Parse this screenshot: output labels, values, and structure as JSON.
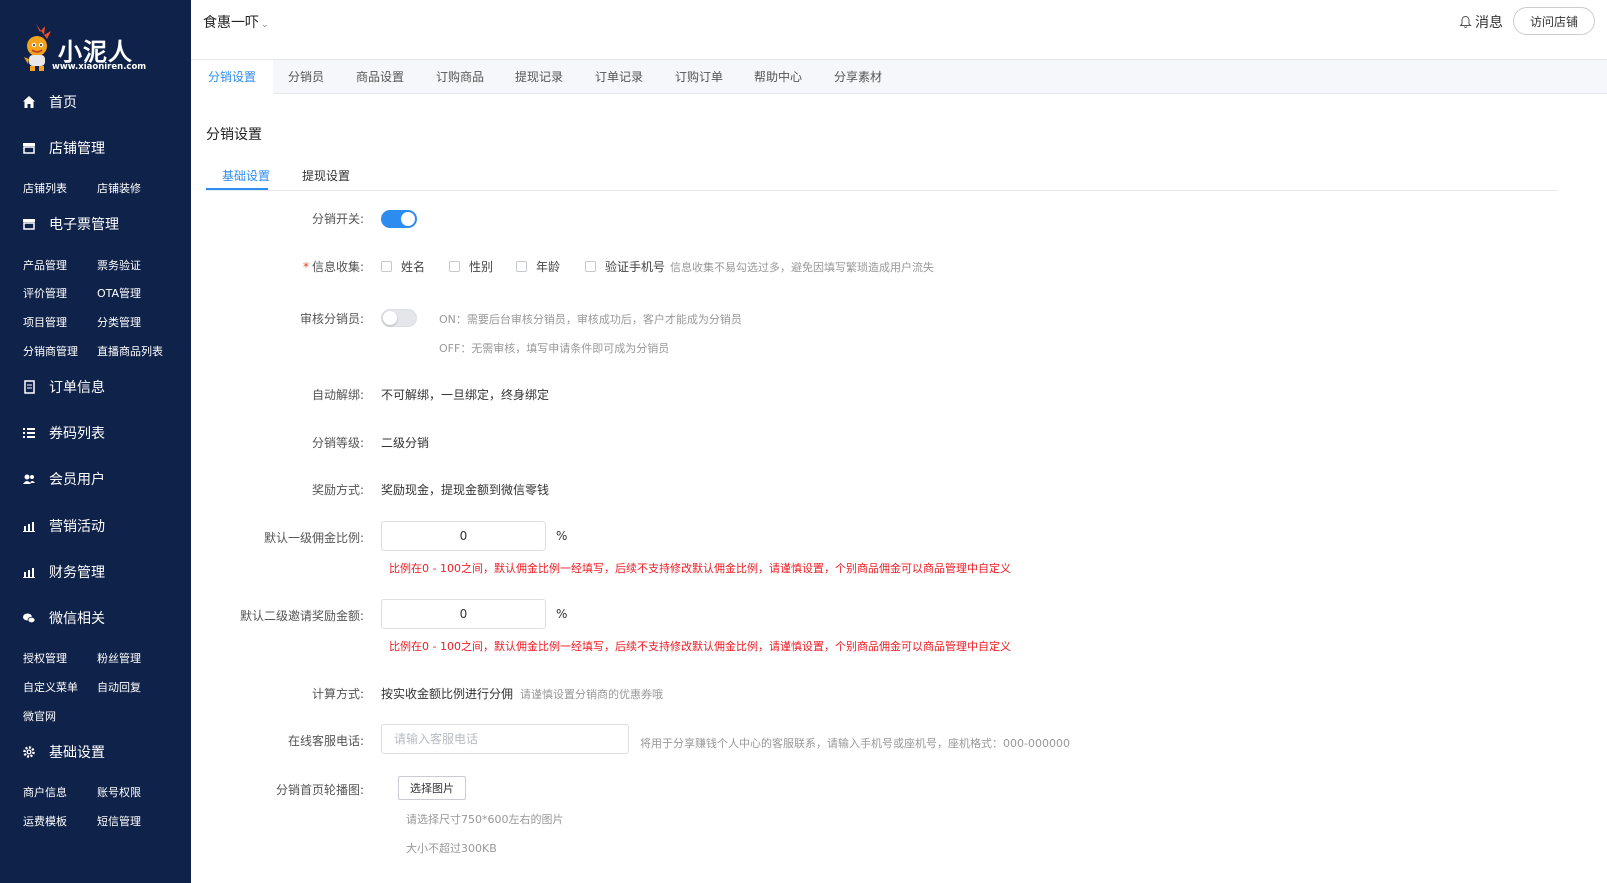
{
  "brand": {
    "name": "小泥人",
    "url": "www.xiaoniren.com"
  },
  "sidebar": {
    "home": "首页",
    "store": {
      "label": "店铺管理",
      "items": [
        "店铺列表",
        "店铺装修"
      ]
    },
    "eticket": {
      "label": "电子票管理",
      "items": [
        "产品管理",
        "票务验证",
        "评价管理",
        "OTA管理",
        "项目管理",
        "分类管理",
        "分销商管理",
        "直播商品列表"
      ]
    },
    "orders": "订单信息",
    "coupons": "券码列表",
    "members": "会员用户",
    "marketing": "营销活动",
    "finance": "财务管理",
    "wechat": {
      "label": "微信相关",
      "items": [
        "授权管理",
        "粉丝管理",
        "自定义菜单",
        "自动回复",
        "微官网"
      ]
    },
    "settings": {
      "label": "基础设置",
      "items": [
        "商户信息",
        "账号权限",
        "运费模板",
        "短信管理"
      ]
    }
  },
  "header": {
    "shop_name": "食惠一吓",
    "messages": "消息",
    "visit_store": "访问店铺"
  },
  "topnav": {
    "tabs": [
      "分销设置",
      "分销员",
      "商品设置",
      "订购商品",
      "提现记录",
      "订单记录",
      "订购订单",
      "帮助中心",
      "分享素材"
    ],
    "active": 0
  },
  "page": {
    "title": "分销设置",
    "subtabs": [
      "基础设置",
      "提现设置"
    ],
    "active_subtab": 0
  },
  "form": {
    "switch_label": "分销开关:",
    "switch_on": true,
    "info_label": "信息收集:",
    "info_options": [
      "姓名",
      "性别",
      "年龄",
      "验证手机号"
    ],
    "info_hint": "信息收集不易勾选过多，避免因填写繁琐造成用户流失",
    "review_label": "审核分销员:",
    "review_on": false,
    "review_hint_on": "ON：需要后台审核分销员，审核成功后，客户才能成为分销员",
    "review_hint_off": "OFF：无需审核，填写申请条件即可成为分销员",
    "unbind_label": "自动解绑:",
    "unbind_value": "不可解绑，一旦绑定，终身绑定",
    "level_label": "分销等级:",
    "level_value": "二级分销",
    "reward_label": "奖励方式:",
    "reward_value": "奖励现金，提现金额到微信零钱",
    "rate1_label": "默认一级佣金比例:",
    "rate1_value": "0",
    "rate2_label": "默认二级邀请奖励金额:",
    "rate2_value": "0",
    "percent": "%",
    "rate_warning": "比例在0 - 100之间，默认佣金比例一经填写，后续不支持修改默认佣金比例，请谨慎设置，个别商品佣金可以商品管理中自定义",
    "calc_label": "计算方式:",
    "calc_value": "按实收金额比例进行分佣",
    "calc_hint": "请谨慎设置分销商的优惠券哦",
    "phone_label": "在线客服电话:",
    "phone_placeholder": "请输入客服电话",
    "phone_hint": "将用于分享赚钱个人中心的客服联系，请输入手机号或座机号，座机格式：000-000000",
    "banner_label": "分销首页轮播图:",
    "banner_button": "选择图片",
    "banner_hint_size": "请选择尺寸750*600左右的图片",
    "banner_hint_limit": "大小不超过300KB"
  },
  "colors": {
    "sidebar_bg": "#0f2249",
    "accent": "#2d8cf0",
    "warning": "#ed1c24"
  }
}
